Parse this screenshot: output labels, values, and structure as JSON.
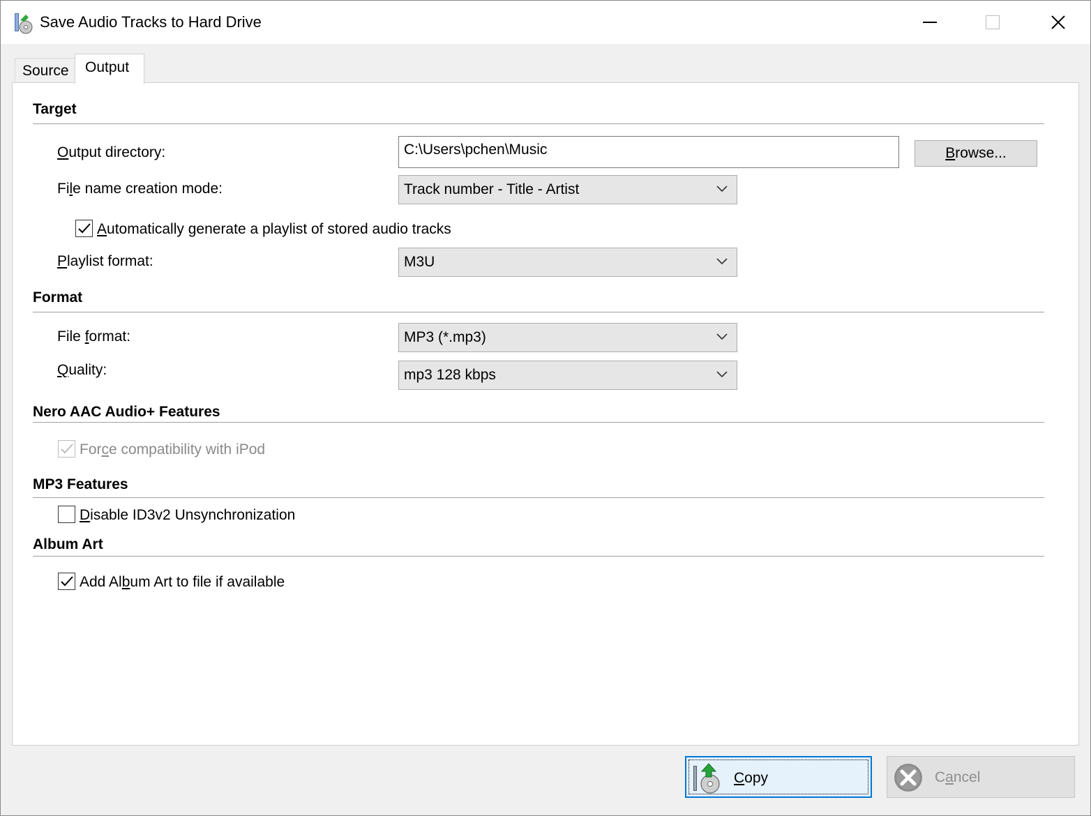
{
  "window": {
    "title": "Save Audio Tracks to Hard Drive"
  },
  "tabs": [
    {
      "label": "Source",
      "selected": false
    },
    {
      "label": "Output",
      "selected": true
    }
  ],
  "sections": {
    "target": "Target",
    "format": "Format",
    "nero": "Nero AAC Audio+ Features",
    "mp3": "MP3 Features",
    "album_art": "Album Art"
  },
  "target": {
    "output_directory_label_mnemonic": "O",
    "output_directory_label_rest": "utput directory:",
    "output_directory_value": "C:\\Users\\pchen\\Music",
    "browse_label_mnemonic": "B",
    "browse_label_rest": "rowse...",
    "file_name_mode_label_pre": "Fi",
    "file_name_mode_label_mnemonic": "l",
    "file_name_mode_label_post": "e name creation mode:",
    "file_name_mode_value": "Track number - Title - Artist",
    "auto_playlist_mnemonic": "A",
    "auto_playlist_rest": "utomatically generate a playlist of stored audio tracks",
    "auto_playlist_checked": true,
    "playlist_format_mnemonic": "P",
    "playlist_format_rest": "laylist format:",
    "playlist_format_value": "M3U"
  },
  "format": {
    "file_format_label_pre": "File ",
    "file_format_label_mnemonic": "f",
    "file_format_label_post": "ormat:",
    "file_format_value": "MP3 (*.mp3)",
    "quality_label_mnemonic": "Q",
    "quality_label_rest": "uality:",
    "quality_value": "mp3 128 kbps"
  },
  "nero": {
    "force_ipod_pre": "For",
    "force_ipod_mnemonic": "c",
    "force_ipod_post": "e compatibility with iPod",
    "force_ipod_checked": true,
    "force_ipod_enabled": false
  },
  "mp3": {
    "disable_id3_mnemonic": "D",
    "disable_id3_rest": "isable ID3v2 Unsynchronization",
    "disable_id3_checked": false
  },
  "album_art": {
    "add_art_pre": "Add Al",
    "add_art_mnemonic": "b",
    "add_art_post": "um Art to file if available",
    "add_art_checked": true
  },
  "buttons": {
    "copy_mnemonic": "C",
    "copy_rest": "opy",
    "cancel_pre": "C",
    "cancel_mnemonic": "a",
    "cancel_post": "ncel"
  },
  "colors": {
    "accent_focus": "#0078d7",
    "panel_bg": "#ffffff",
    "dialog_bg": "#f0f0f0"
  }
}
